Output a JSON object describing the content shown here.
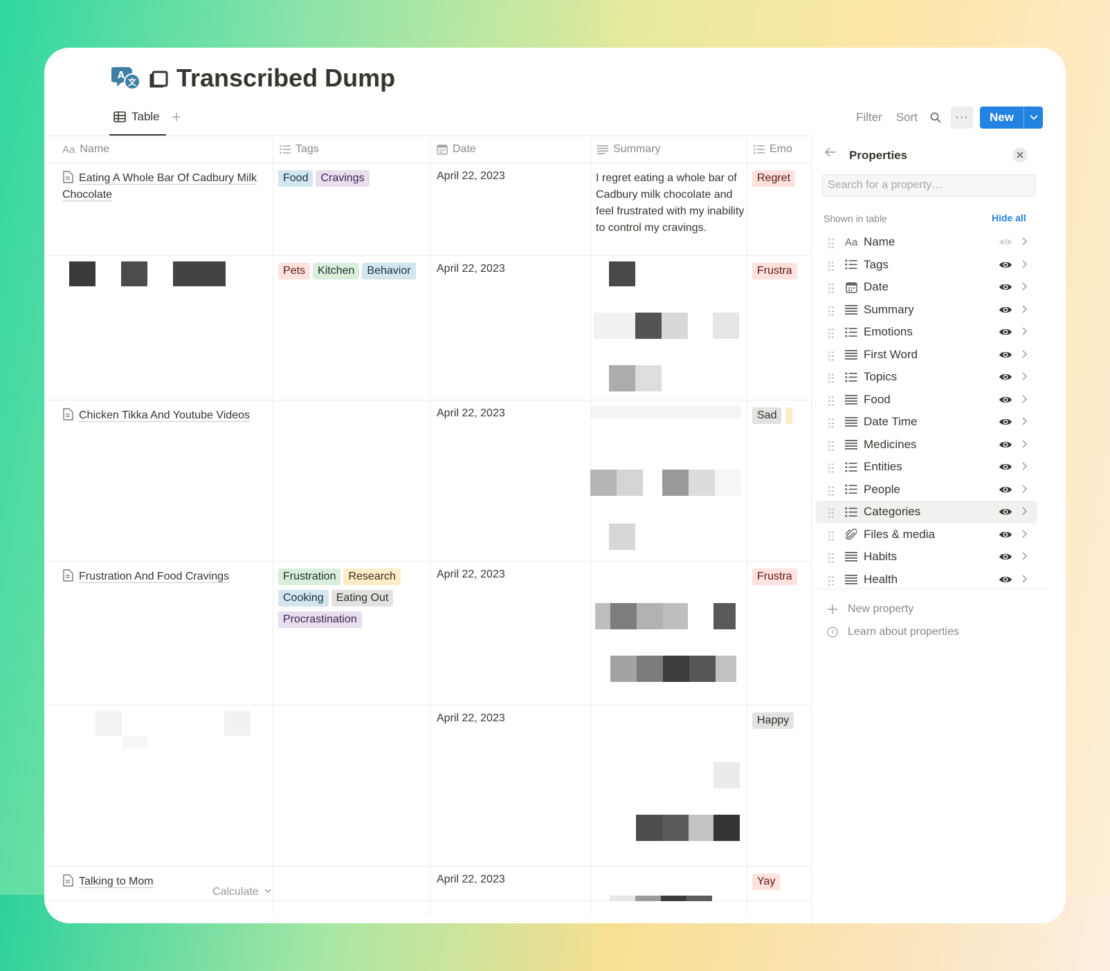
{
  "page": {
    "title": "Transcribed Dump",
    "icon": "translate-chat-icon",
    "title_emoji": "square-icon"
  },
  "views": {
    "tabs": [
      {
        "label": "Table",
        "icon": "table-icon"
      }
    ],
    "add_icon": "plus-icon"
  },
  "toolbar": {
    "filter_label": "Filter",
    "sort_label": "Sort",
    "search_icon": "search-icon",
    "more_label": "···",
    "new_label": "New"
  },
  "table": {
    "columns": [
      {
        "label": "Name",
        "icon": "text-type-icon"
      },
      {
        "label": "Tags",
        "icon": "list-icon"
      },
      {
        "label": "Date",
        "icon": "calendar-icon"
      },
      {
        "label": "Summary",
        "icon": "lines-icon"
      },
      {
        "label": "Emo",
        "icon": "list-icon"
      }
    ],
    "rows": [
      {
        "name": "Eating A Whole Bar Of Cadbury Milk Chocolate",
        "tags": [
          "Food",
          "Cravings"
        ],
        "date": "April 22, 2023",
        "summary": "I regret eating a whole bar of Cadbury milk chocolate and feel frustrated with my inability to control my cravings.",
        "emotions": [
          "Regret"
        ]
      },
      {
        "name": "",
        "tags": [
          "Pets",
          "Kitchen",
          "Behavior"
        ],
        "date": "April 22, 2023",
        "summary": "",
        "emotions": [
          "Frustra"
        ]
      },
      {
        "name": "Chicken Tikka And Youtube Videos",
        "tags": [],
        "date": "April 22, 2023",
        "summary": "",
        "emotions": [
          "Sad"
        ]
      },
      {
        "name": "Frustration And Food Cravings",
        "tags": [
          "Frustration",
          "Research",
          "Cooking",
          "Eating Out",
          "Procrastination"
        ],
        "date": "April 22, 2023",
        "summary": "",
        "emotions": [
          "Frustra"
        ]
      },
      {
        "name": "",
        "tags": [],
        "date": "April 22, 2023",
        "summary": "",
        "emotions": [
          "Happy"
        ]
      },
      {
        "name": "Talking to Mom",
        "tags": [],
        "date": "April 22, 2023",
        "summary": "",
        "emotions": [
          "Yay"
        ]
      }
    ],
    "calculate_label": "Calculate"
  },
  "tag_colors": {
    "Food": "#d3e5ef",
    "Cravings": "#e8deee",
    "Pets": "#ffe2dd",
    "Kitchen": "#dbeddb",
    "Behavior": "#d3e5ef",
    "Frustration": "#dbeddb",
    "Research": "#fdecc8",
    "Cooking": "#d3e5ef",
    "Eating Out": "#e3e2e0",
    "Procrastination": "#e8deee",
    "Regret": "#ffe2dd",
    "Frustra": "#ffe2dd",
    "Sad": "#e3e2e0",
    "Happy": "#e3e2e0",
    "Yay": "#ffe2dd"
  },
  "properties_panel": {
    "title": "Properties",
    "search_placeholder": "Search for a property…",
    "shown_label": "Shown in table",
    "hide_all_label": "Hide all",
    "properties": [
      {
        "name": "Name",
        "icon": "text-type-icon",
        "visible_toggle": false
      },
      {
        "name": "Tags",
        "icon": "list-icon",
        "visible_toggle": true
      },
      {
        "name": "Date",
        "icon": "calendar-icon",
        "visible_toggle": true
      },
      {
        "name": "Summary",
        "icon": "lines-icon",
        "visible_toggle": true
      },
      {
        "name": "Emotions",
        "icon": "list-icon",
        "visible_toggle": true
      },
      {
        "name": "First Word",
        "icon": "lines-icon",
        "visible_toggle": true
      },
      {
        "name": "Topics",
        "icon": "list-icon",
        "visible_toggle": true
      },
      {
        "name": "Food",
        "icon": "lines-icon",
        "visible_toggle": true
      },
      {
        "name": "Date Time",
        "icon": "lines-icon",
        "visible_toggle": true
      },
      {
        "name": "Medicines",
        "icon": "lines-icon",
        "visible_toggle": true
      },
      {
        "name": "Entities",
        "icon": "list-icon",
        "visible_toggle": true
      },
      {
        "name": "People",
        "icon": "list-icon",
        "visible_toggle": true
      },
      {
        "name": "Categories",
        "icon": "list-icon",
        "visible_toggle": true,
        "active": true
      },
      {
        "name": "Files & media",
        "icon": "paperclip-icon",
        "visible_toggle": true
      },
      {
        "name": "Habits",
        "icon": "lines-icon",
        "visible_toggle": true
      },
      {
        "name": "Health",
        "icon": "lines-icon",
        "visible_toggle": true
      }
    ],
    "new_property_label": "New property",
    "learn_label": "Learn about properties"
  },
  "colors": {
    "accent": "#2383e2",
    "text": "#37352f",
    "muted": "#8a8985"
  }
}
